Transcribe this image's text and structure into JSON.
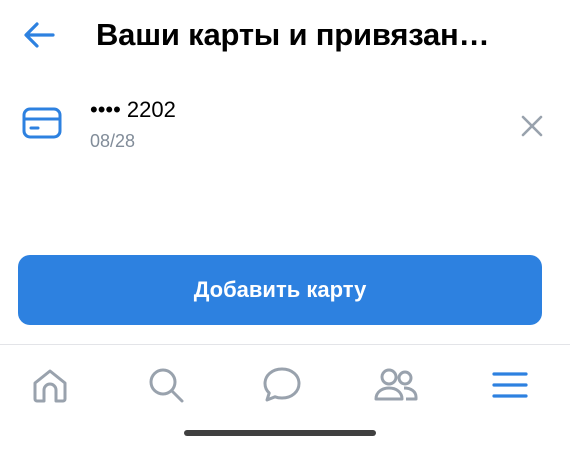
{
  "header": {
    "title": "Ваши карты и привязан…",
    "back_icon": "arrow-left-icon"
  },
  "card": {
    "icon": "credit-card-icon",
    "number": "•••• 2202",
    "expiry": "08/28",
    "remove_icon": "close-icon"
  },
  "add_card_label": "Добавить карту",
  "tabbar": {
    "items": [
      {
        "icon": "home-icon"
      },
      {
        "icon": "search-icon"
      },
      {
        "icon": "messages-icon"
      },
      {
        "icon": "friends-icon"
      },
      {
        "icon": "menu-icon",
        "active": true
      }
    ]
  },
  "colors": {
    "accent": "#2d81e0",
    "secondary_text": "#818c99",
    "inactive_icon": "#99a2ad",
    "close_icon": "#99a2ad",
    "active_tab": "#2d81e0"
  }
}
